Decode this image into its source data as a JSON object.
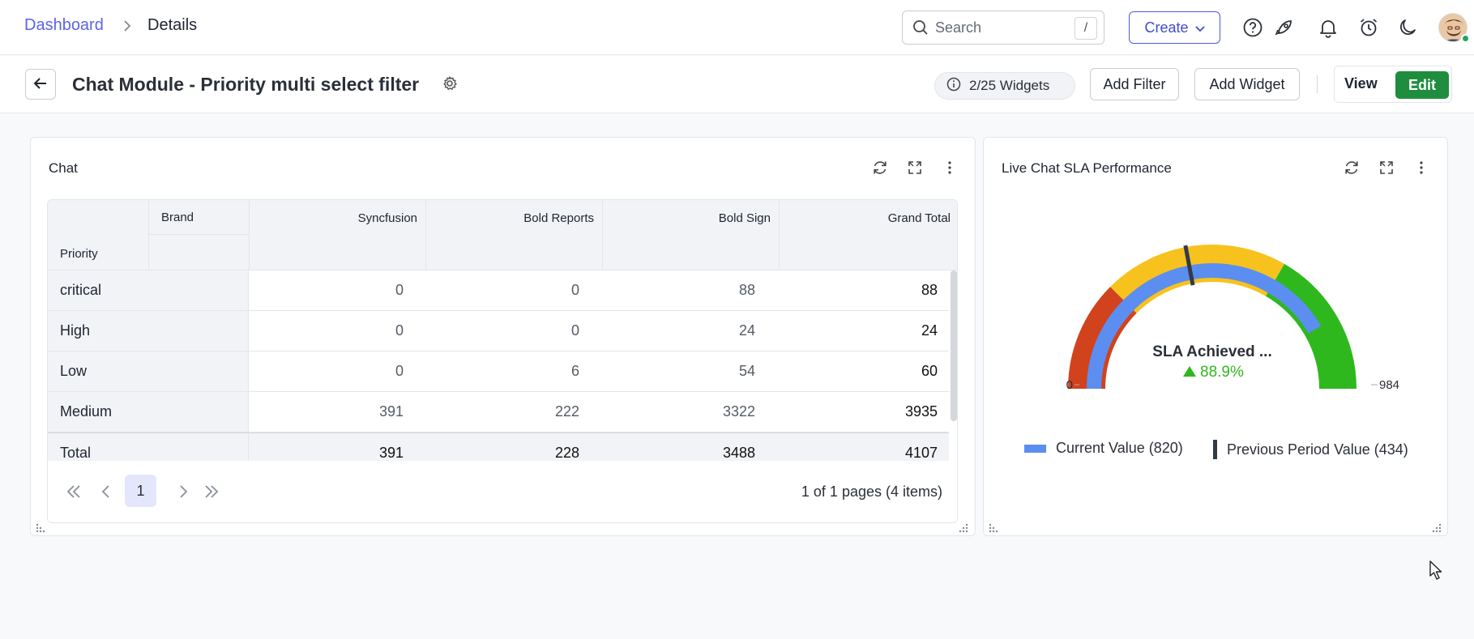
{
  "breadcrumb": {
    "home": "Dashboard",
    "current": "Details"
  },
  "search": {
    "placeholder": "Search",
    "shortcut": "/"
  },
  "header": {
    "create_label": "Create"
  },
  "titlebar": {
    "title": "Chat Module - Priority multi select filter",
    "widgets_count": "2/25 Widgets",
    "add_filter": "Add Filter",
    "add_widget": "Add Widget",
    "view": "View",
    "edit": "Edit"
  },
  "chat_widget": {
    "title": "Chat",
    "column_field": "Brand",
    "row_field": "Priority",
    "columns": [
      "Syncfusion",
      "Bold Reports",
      "Bold Sign",
      "Grand Total"
    ],
    "rows": [
      {
        "label": "critical",
        "values": [
          "0",
          "0",
          "88",
          "88"
        ]
      },
      {
        "label": "High",
        "values": [
          "0",
          "0",
          "24",
          "24"
        ]
      },
      {
        "label": "Low",
        "values": [
          "0",
          "6",
          "54",
          "60"
        ]
      },
      {
        "label": "Medium",
        "values": [
          "391",
          "222",
          "3322",
          "3935"
        ]
      }
    ],
    "total": {
      "label": "Total",
      "values": [
        "391",
        "228",
        "3488",
        "4107"
      ]
    },
    "pager": {
      "current_page": "1",
      "info": "1 of 1 pages (4 items)"
    }
  },
  "sla_widget": {
    "title": "Live Chat SLA Performance",
    "center_label": "SLA Achieved ...",
    "percent": "88.9%",
    "min_label": "0",
    "max_label": "984",
    "legend_current": "Current Value (820)",
    "legend_previous": "Previous Period Value (434)",
    "colors": {
      "current": "#5b8ef0",
      "red": "#d0431d",
      "yellow": "#f7c21e",
      "green": "#2fb81e",
      "marker": "#333a48"
    }
  },
  "chart_data": {
    "type": "gauge",
    "min": 0,
    "max": 984,
    "current_value": 820,
    "previous_value": 434,
    "bands": [
      {
        "from": 0,
        "to": 246,
        "color": "#d0431d"
      },
      {
        "from": 246,
        "to": 656,
        "color": "#f7c21e"
      },
      {
        "from": 656,
        "to": 984,
        "color": "#2fb81e"
      }
    ],
    "center_label": "SLA Achieved ...",
    "percent_change": "88.9%"
  }
}
